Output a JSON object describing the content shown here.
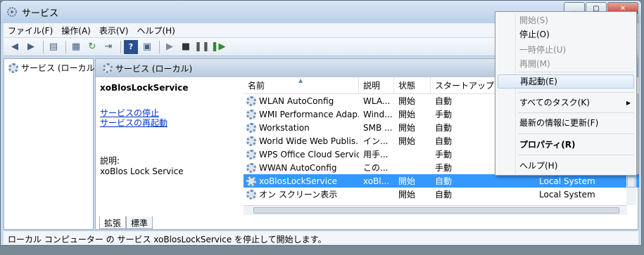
{
  "window": {
    "title": "サービス"
  },
  "menubar": [
    "ファイル(F)",
    "操作(A)",
    "表示(V)",
    "ヘルプ(H)"
  ],
  "tree": {
    "item": "サービス (ローカル)"
  },
  "main": {
    "header": "サービス (ローカル)"
  },
  "details": {
    "service_name": "xoBlosLockService",
    "stop_link": "サービスの停止",
    "restart_link": "サービスの再起動",
    "desc_label": "説明:",
    "desc_text": "xoBlos Lock Service"
  },
  "columns": [
    "名前",
    "説明",
    "状態",
    "スタートアップ",
    ""
  ],
  "rows": [
    {
      "name": "WLAN AutoConfig",
      "desc": "WLA...",
      "status": "開始",
      "startup": "自動",
      "logon": ""
    },
    {
      "name": "WMI Performance Adap...",
      "desc": "Wind...",
      "status": "開始",
      "startup": "手動",
      "logon": ""
    },
    {
      "name": "Workstation",
      "desc": "SMB ...",
      "status": "開始",
      "startup": "自動",
      "logon": ""
    },
    {
      "name": "World Wide Web Publis...",
      "desc": "イン...",
      "status": "開始",
      "startup": "自動",
      "logon": ""
    },
    {
      "name": "WPS Office Cloud Service",
      "desc": "用手...",
      "status": "",
      "startup": "手動",
      "logon": ""
    },
    {
      "name": "WWAN AutoConfig",
      "desc": "この...",
      "status": "",
      "startup": "手動",
      "logon": ""
    },
    {
      "name": "xoBlosLockService",
      "desc": "xoBl...",
      "status": "開始",
      "startup": "自動",
      "logon": "Local System",
      "selected": true
    },
    {
      "name": "オン スクリーン表示",
      "desc": "",
      "status": "開始",
      "startup": "自動",
      "logon": "Local System"
    }
  ],
  "tabs": [
    "拡張",
    "標準"
  ],
  "status": "ローカル コンピューター の サービス xoBlosLockService を停止して開始します。",
  "context_menu": [
    {
      "label": "開始(S)",
      "disabled": true
    },
    {
      "label": "停止(O)"
    },
    {
      "label": "一時停止(U)",
      "disabled": true
    },
    {
      "label": "再開(M)",
      "disabled": true
    },
    {
      "label": "再起動(E)",
      "highlighted": true
    },
    {
      "label": "すべてのタスク(K)",
      "submenu": true
    },
    {
      "label": "最新の情報に更新(F)"
    },
    {
      "label": "プロパティ(R)",
      "bold": true
    },
    {
      "label": "ヘルプ(H)"
    }
  ]
}
